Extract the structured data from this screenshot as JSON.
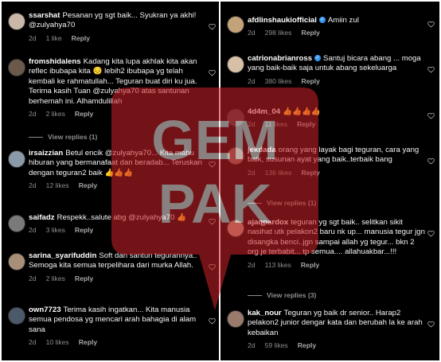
{
  "left_comments": [
    {
      "user": "ssarshat",
      "text": "Pesanan yg sgt baik... Syukran ya akhi! @zulyahya70",
      "time": "2d",
      "likes": "1 like",
      "reply": "Reply"
    },
    {
      "user": "fromshidalens",
      "text": "Kadang kita lupa akhlak kita akan reflec ibubapa kita 😔 lebih2 ibubapa yg telah kembali ke rahmatullah... Teguran buat diri ku jua. Terima kasih Tuan @zulyahya70 atas santunan berhemah ini. Alhamdulillah",
      "time": "2d",
      "likes": "2 likes",
      "reply": "Reply",
      "view_replies": "View replies (1)"
    },
    {
      "user": "irsaizzian",
      "text": "Betul encik @zulyahya70... Kita mahu hiburan yang bermanafaat dan beradab... Teruskan dengan teguran2 baik 👍👍👍",
      "time": "2d",
      "likes": "12 likes",
      "reply": "Reply"
    },
    {
      "user": "saifadz",
      "text": "Respekk..salute abg @zulyahya70 👍",
      "time": "2d",
      "likes": "3 likes",
      "reply": "Reply"
    },
    {
      "user": "sarina_syarifuddin",
      "text": "Soft dan santun tegurannya.. Semoga kita semua terpelihara dari murka Allah.",
      "time": "2d",
      "likes": "2 likes",
      "reply": "Reply"
    },
    {
      "user": "own7723",
      "text": "Terima kasih ingatkan... Kita manusia semua pendosa yg mencari arah bahagia di alam sana",
      "time": "2d",
      "likes": "10 likes",
      "reply": "Reply"
    }
  ],
  "right_comments": [
    {
      "user": "afdlinshaukiofficial",
      "verified": true,
      "text": "Amiin zul",
      "time": "2d",
      "likes": "298 likes",
      "reply": "Reply"
    },
    {
      "user": "catrionabrianross",
      "verified": true,
      "text": "Santuj bicara abang ... moga yang baik-baik saja untuk abang sekeluarga",
      "time": "2d",
      "likes": "380 likes",
      "reply": "Reply"
    },
    {
      "user": "4d4m_04",
      "text": "👍👍👍👍",
      "time": "2d",
      "likes": "11 likes",
      "reply": "Reply"
    },
    {
      "user": "jekdada",
      "text": "orang yang layak bagi teguran, cara yang baik, susunan ayat yang baik..terbaik bang",
      "time": "2d",
      "likes": "136 likes",
      "reply": "Reply",
      "view_replies": "View replies (1)"
    },
    {
      "user": "ajaqpardox",
      "text": "teguran yg sgt baik.. selitkan sikit nasihat utk pelakon2 baru nk up... manusia tegur jgn disangka benci..jgn sampai allah yg tegur... bkn 2 org je terbabit... tp semua.... allahuakbar...!!!",
      "time": "2d",
      "likes": "113 likes",
      "reply": "Reply",
      "view_replies": "View replies (3)"
    },
    {
      "user": "kak_nour",
      "text": "Teguran yg baik dr senior.. Harap2 pelakon2 junior dengar kata dan berubah la ke arah kebaikan",
      "time": "2d",
      "likes": "59 likes",
      "reply": "Reply"
    }
  ],
  "watermark": {
    "line1": "GEM",
    "line2": "PAK",
    "color": "#d2232a"
  },
  "colors": {
    "background": "#000000",
    "text": "#f5f5f5",
    "meta": "#8e8e8e",
    "verified": "#3897f0"
  },
  "icons": {
    "heart": "heart-outline-icon",
    "verified": "verified-badge-icon"
  }
}
